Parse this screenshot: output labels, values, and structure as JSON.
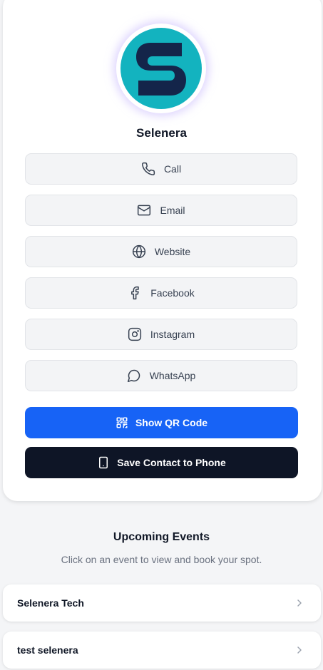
{
  "profile": {
    "name": "Selenera",
    "logo_letter": "S",
    "logo_bg": "#13b3bf",
    "logo_fg": "#14254a"
  },
  "links": [
    {
      "label": "Call",
      "icon": "phone-icon"
    },
    {
      "label": "Email",
      "icon": "mail-icon"
    },
    {
      "label": "Website",
      "icon": "globe-icon"
    },
    {
      "label": "Facebook",
      "icon": "facebook-icon"
    },
    {
      "label": "Instagram",
      "icon": "instagram-icon"
    },
    {
      "label": "WhatsApp",
      "icon": "whatsapp-icon"
    }
  ],
  "actions": {
    "qr_label": "Show QR Code",
    "qr_icon": "qr-code-icon",
    "qr_color": "#1763f6",
    "save_label": "Save Contact to Phone",
    "save_icon": "smartphone-icon",
    "save_color": "#0e1526"
  },
  "events": {
    "title": "Upcoming Events",
    "subtitle": "Click on an event to view and book your spot.",
    "items": [
      {
        "label": "Selenera Tech"
      },
      {
        "label": "test selenera"
      }
    ]
  }
}
